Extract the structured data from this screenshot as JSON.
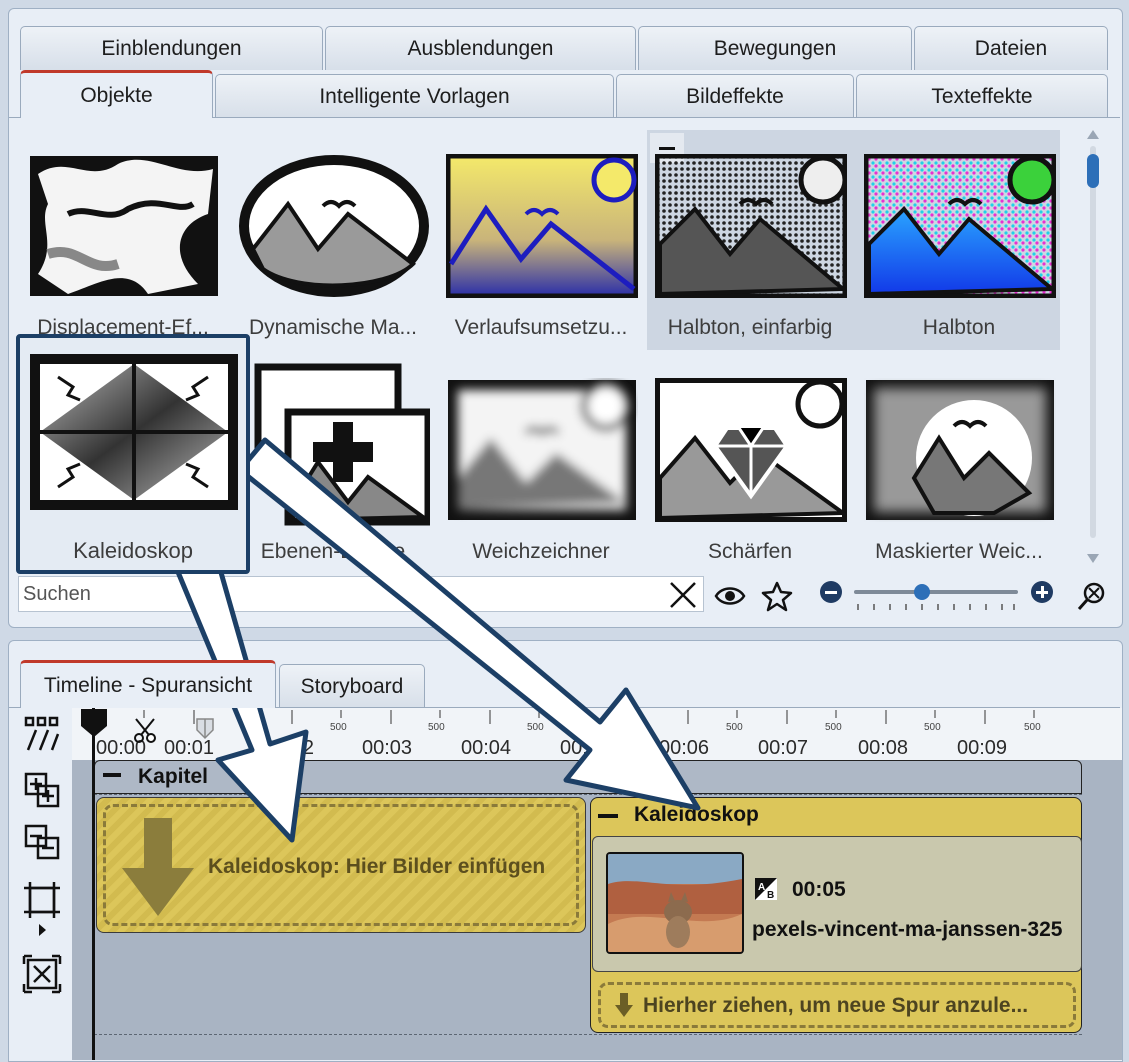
{
  "tabs_row1": [
    "Einblendungen",
    "Ausblendungen",
    "Bewegungen",
    "Dateien"
  ],
  "tabs_row2": [
    "Objekte",
    "Intelligente Vorlagen",
    "Bildeffekte",
    "Texteffekte"
  ],
  "items": [
    {
      "label": "Displacement-Ef...",
      "icon": "displacement-thumbnail"
    },
    {
      "label": "Dynamische Ma...",
      "icon": "dynamic-mask-thumbnail"
    },
    {
      "label": "Verlaufsumsetzu...",
      "icon": "gradient-map-thumbnail"
    },
    {
      "label": "Halbton, einfarbig",
      "icon": "halftone-mono-thumbnail"
    },
    {
      "label": "Halbton",
      "icon": "halftone-color-thumbnail"
    },
    {
      "label": "Kaleidoskop",
      "icon": "kaleidoscope-thumbnail"
    },
    {
      "label": "Ebenen-Effekte",
      "icon": "layer-effects-thumbnail"
    },
    {
      "label": "Weichzeichner",
      "icon": "blur-thumbnail"
    },
    {
      "label": "Schärfen",
      "icon": "sharpen-thumbnail"
    },
    {
      "label": "Maskierter Weic...",
      "icon": "masked-blur-thumbnail"
    }
  ],
  "search": {
    "placeholder": "Suchen"
  },
  "timeline_tabs": [
    "Timeline - Spuransicht",
    "Storyboard"
  ],
  "ruler": {
    "times": [
      "00:00",
      "00:01",
      "00:02",
      "00:03",
      "00:04",
      "00:05",
      "00:06",
      "00:07",
      "00:08",
      "00:09"
    ],
    "half": "500"
  },
  "chapter": {
    "label": "Kapitel"
  },
  "placeholder_text": "Kaleidoskop: Hier Bilder einfügen",
  "kaleido_block": {
    "title": "Kaleidoskop",
    "clip_duration": "00:05",
    "clip_name": "pexels-vincent-ma-janssen-325",
    "drop_hint": "Hierher ziehen, um neue Spur anzule..."
  },
  "colors": {
    "accent_red": "#c0392b",
    "yellow": "#dcc65a",
    "callout_border": "#1c3f66"
  }
}
